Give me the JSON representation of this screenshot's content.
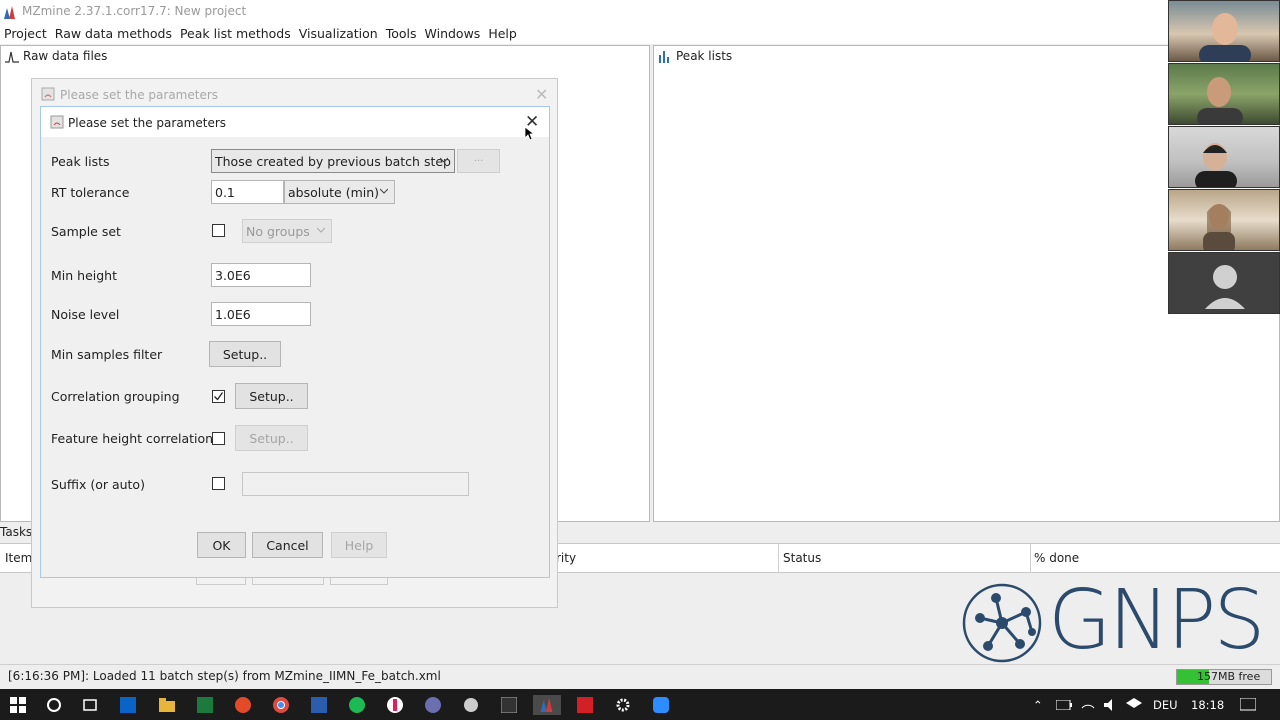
{
  "app": {
    "title": "MZmine 2.37.1.corr17.7: New project",
    "menu": [
      "Project",
      "Raw data methods",
      "Peak list methods",
      "Visualization",
      "Tools",
      "Windows",
      "Help"
    ]
  },
  "panels": {
    "raw": {
      "title": "Raw data files"
    },
    "peak": {
      "title": "Peak lists"
    }
  },
  "tasks": {
    "label": "Tasks",
    "columns": {
      "item": "Item",
      "priority": "rity",
      "status": "Status",
      "percent": "% done"
    }
  },
  "outer_dialog": {
    "title": "Please set the parameters"
  },
  "dialog": {
    "title": "Please set the parameters",
    "peak_lists": {
      "label": "Peak lists",
      "value": "Those created by previous batch step",
      "extra_button": "..."
    },
    "rt_tolerance": {
      "label": "RT tolerance",
      "value": "0.1",
      "unit": "absolute (min)"
    },
    "sample_set": {
      "label": "Sample set",
      "checked": false,
      "combo": "No groups"
    },
    "min_height": {
      "label": "Min height",
      "value": "3.0E6"
    },
    "noise_level": {
      "label": "Noise level",
      "value": "1.0E6"
    },
    "min_samples": {
      "label": "Min samples filter",
      "button": "Setup.."
    },
    "correlation_grouping": {
      "label": "Correlation grouping",
      "checked": true,
      "button": "Setup.."
    },
    "feature_height": {
      "label": "Feature height correlation",
      "checked": false,
      "button": "Setup.."
    },
    "suffix": {
      "label": "Suffix (or auto)",
      "checked": false,
      "value": ""
    },
    "buttons": {
      "ok": "OK",
      "cancel": "Cancel",
      "help": "Help"
    }
  },
  "statusbar": {
    "message": "[6:16:36 PM]: Loaded 11 batch step(s) from MZmine_IIMN_Fe_batch.xml",
    "memory": "157MB free"
  },
  "gnps": {
    "text": "GNPS"
  },
  "taskbar": {
    "language": "DEU",
    "time": "18:18"
  },
  "colors": {
    "accent": "#34c234",
    "gnps": "#2c4a6b"
  }
}
